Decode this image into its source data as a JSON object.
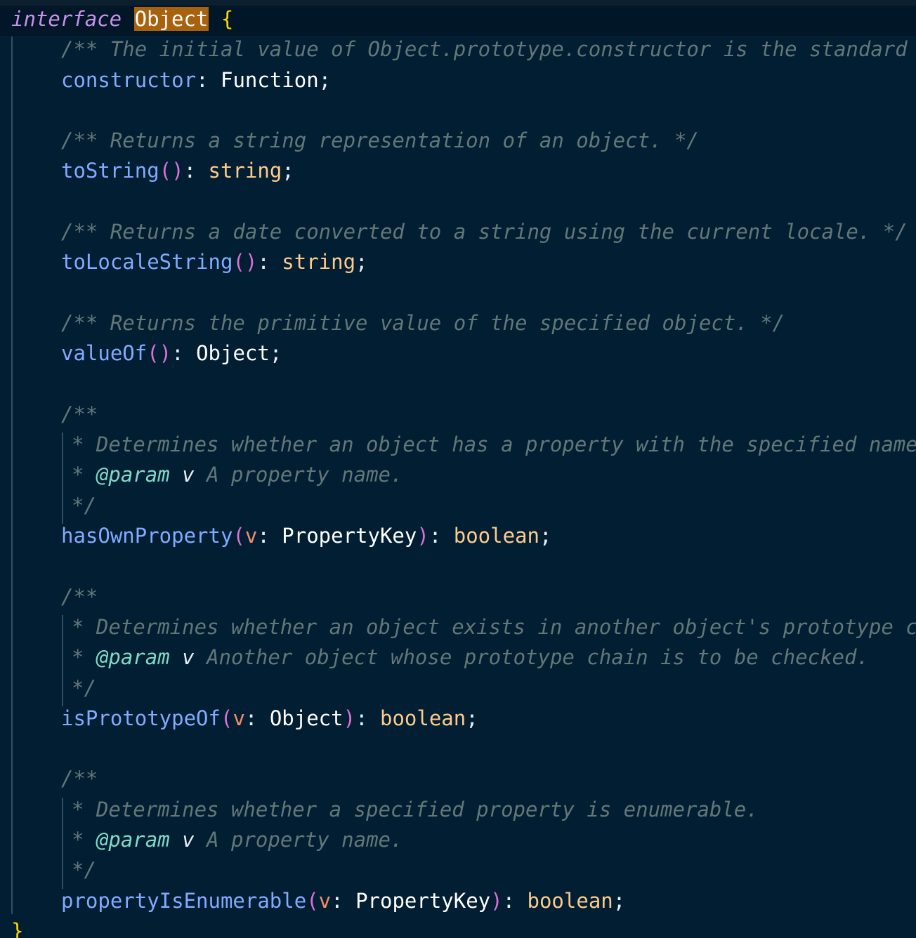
{
  "editor": {
    "lines": [
      {
        "type": "header",
        "keyword": "interface",
        "name": "Object",
        "brace": "{"
      },
      {
        "type": "doc",
        "text": "/** The initial value of Object.prototype.constructor is the standard built-in Object constructor. */"
      },
      {
        "type": "member",
        "prop": "constructor",
        "ret": "Function"
      },
      {
        "type": "blank"
      },
      {
        "type": "doc",
        "text": "/** Returns a string representation of an object. */"
      },
      {
        "type": "method",
        "prop": "toString",
        "ret": "string"
      },
      {
        "type": "blank"
      },
      {
        "type": "doc",
        "text": "/** Returns a date converted to a string using the current locale. */"
      },
      {
        "type": "method",
        "prop": "toLocaleString",
        "ret": "string"
      },
      {
        "type": "blank"
      },
      {
        "type": "doc",
        "text": "/** Returns the primitive value of the specified object. */"
      },
      {
        "type": "method",
        "prop": "valueOf",
        "ret": "Object"
      },
      {
        "type": "blank"
      },
      {
        "type": "doc-open",
        "text": "/**"
      },
      {
        "type": "doc-inner",
        "text": "* Determines whether an object has a property with the specified name."
      },
      {
        "type": "doc-param",
        "star": "* ",
        "tag": "@param",
        "param": "v",
        "desc": "A property name."
      },
      {
        "type": "doc-inner",
        "text": "*/"
      },
      {
        "type": "method-arg",
        "prop": "hasOwnProperty",
        "arg": "v",
        "argType": "PropertyKey",
        "ret": "boolean"
      },
      {
        "type": "blank"
      },
      {
        "type": "doc-open",
        "text": "/**"
      },
      {
        "type": "doc-inner",
        "text": "* Determines whether an object exists in another object's prototype chain."
      },
      {
        "type": "doc-param",
        "star": "* ",
        "tag": "@param",
        "param": "v",
        "desc": "Another object whose prototype chain is to be checked."
      },
      {
        "type": "doc-inner",
        "text": "*/"
      },
      {
        "type": "method-arg",
        "prop": "isPrototypeOf",
        "arg": "v",
        "argType": "Object",
        "ret": "boolean"
      },
      {
        "type": "blank"
      },
      {
        "type": "doc-open",
        "text": "/**"
      },
      {
        "type": "doc-inner",
        "text": "* Determines whether a specified property is enumerable."
      },
      {
        "type": "doc-param",
        "star": "* ",
        "tag": "@param",
        "param": "v",
        "desc": "A property name."
      },
      {
        "type": "doc-inner",
        "text": "*/"
      },
      {
        "type": "method-arg",
        "prop": "propertyIsEnumerable",
        "arg": "v",
        "argType": "PropertyKey",
        "ret": "boolean"
      },
      {
        "type": "footer",
        "brace": "}"
      }
    ]
  },
  "colors": {
    "background": "#011e32",
    "keyword": "#c792ea",
    "match_highlight": "#a8610c",
    "brace": "#ffd700",
    "comment": "#637777",
    "property": "#82aaff",
    "primitive_type": "#ffcb8b",
    "paren": "#da70d6",
    "parameter": "#f78c6c",
    "jsdoc_tag": "#7fdbca"
  }
}
